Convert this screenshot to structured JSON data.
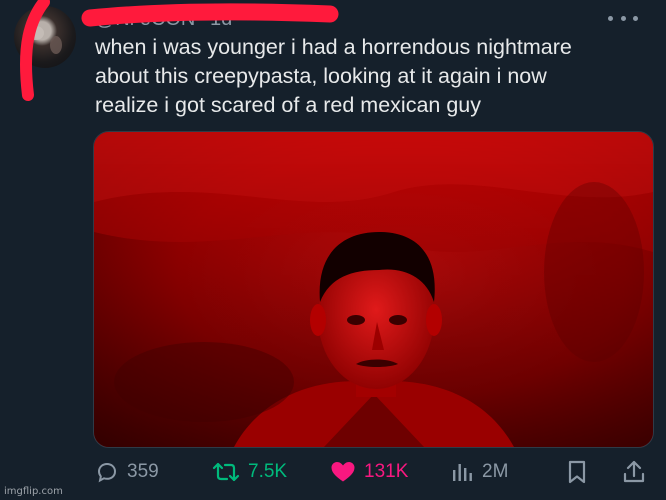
{
  "tweet": {
    "author_handle": "@Ni          eCON",
    "separator": "·",
    "age": "1d",
    "text_lines": [
      "when i was younger i had a horrendous nightmare",
      "about this creepypasta, looking at it again i now",
      "realize i got scared of a red mexican guy"
    ]
  },
  "actions": {
    "replies": "359",
    "retweets": "7.5K",
    "likes": "131K",
    "views": "2M"
  },
  "icons": {
    "more": "more-horizontal-icon",
    "reply": "reply-icon",
    "retweet": "retweet-icon",
    "like": "heart-icon",
    "views": "views-bar-chart-icon",
    "bookmark": "bookmark-icon",
    "share": "share-icon"
  },
  "colors": {
    "background": "#15202b",
    "text": "#e7e9ea",
    "muted": "#8b98a5",
    "retweet_active": "#00ba7c",
    "like_active": "#f91880",
    "redaction": "#ff1a3c"
  },
  "watermark": "imgflip.com"
}
